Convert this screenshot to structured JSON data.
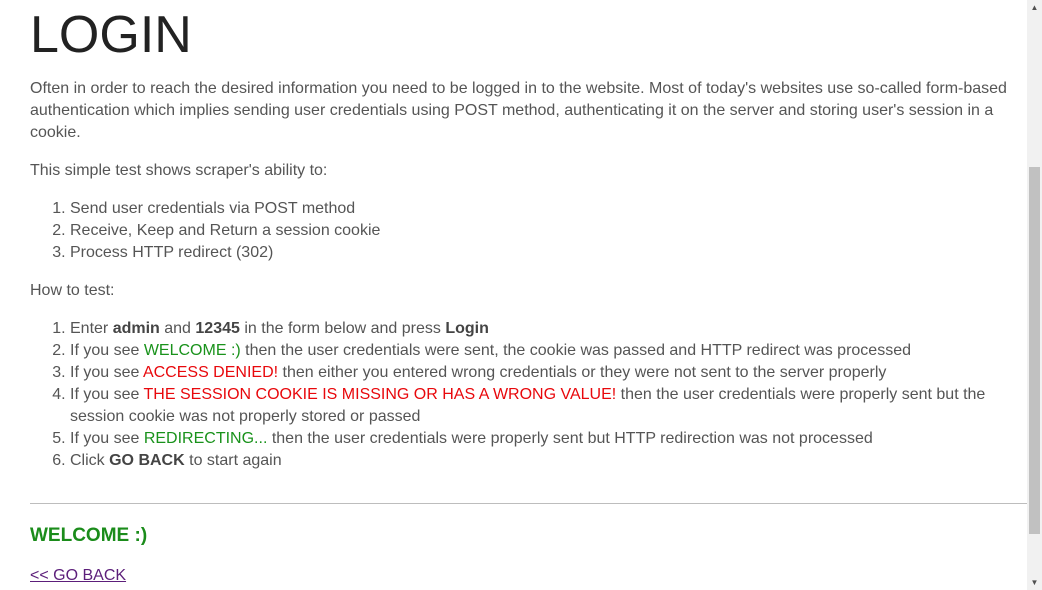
{
  "page": {
    "title": "LOGIN",
    "intro": "Often in order to reach the desired information you need to be logged in to the website. Most of today's websites use so-called form-based authentication which implies sending user credentials using POST method, authenticating it on the server and storing user's session in a cookie.",
    "test_intro": "This simple test shows scraper's ability to:",
    "abilities": [
      "Send user credentials via POST method",
      "Receive, Keep and Return a session cookie",
      "Process HTTP redirect (302)"
    ],
    "howto_label": "How to test:",
    "steps": {
      "s1": {
        "a": "Enter ",
        "user": "admin",
        "b": " and ",
        "pass": "12345",
        "c": " in the form below and press ",
        "btn": "Login"
      },
      "s2": {
        "a": "If you see ",
        "hl": "WELCOME :)",
        "b": " then the user credentials were sent, the cookie was passed and HTTP redirect was processed"
      },
      "s3": {
        "a": "If you see ",
        "hl": "ACCESS DENIED!",
        "b": " then either you entered wrong credentials or they were not sent to the server properly"
      },
      "s4": {
        "a": "If you see ",
        "hl": "THE SESSION COOKIE IS MISSING OR HAS A WRONG VALUE!",
        "b": " then the user credentials were properly sent but the session cookie was not properly stored or passed"
      },
      "s5": {
        "a": "If you see ",
        "hl": "REDIRECTING...",
        "b": " then the user credentials were properly sent but HTTP redirection was not processed"
      },
      "s6": {
        "a": "Click ",
        "btn": "GO BACK",
        "b": " to start again"
      }
    },
    "result": "WELCOME :)",
    "back_link": "<< GO BACK"
  },
  "colors": {
    "success": "#19921b",
    "error": "#e8080c",
    "link_visited": "#5c1e7a"
  },
  "scrollbar": {
    "up_icon": "triangle-up-icon",
    "down_icon": "triangle-down-icon",
    "position_fraction": 1
  }
}
